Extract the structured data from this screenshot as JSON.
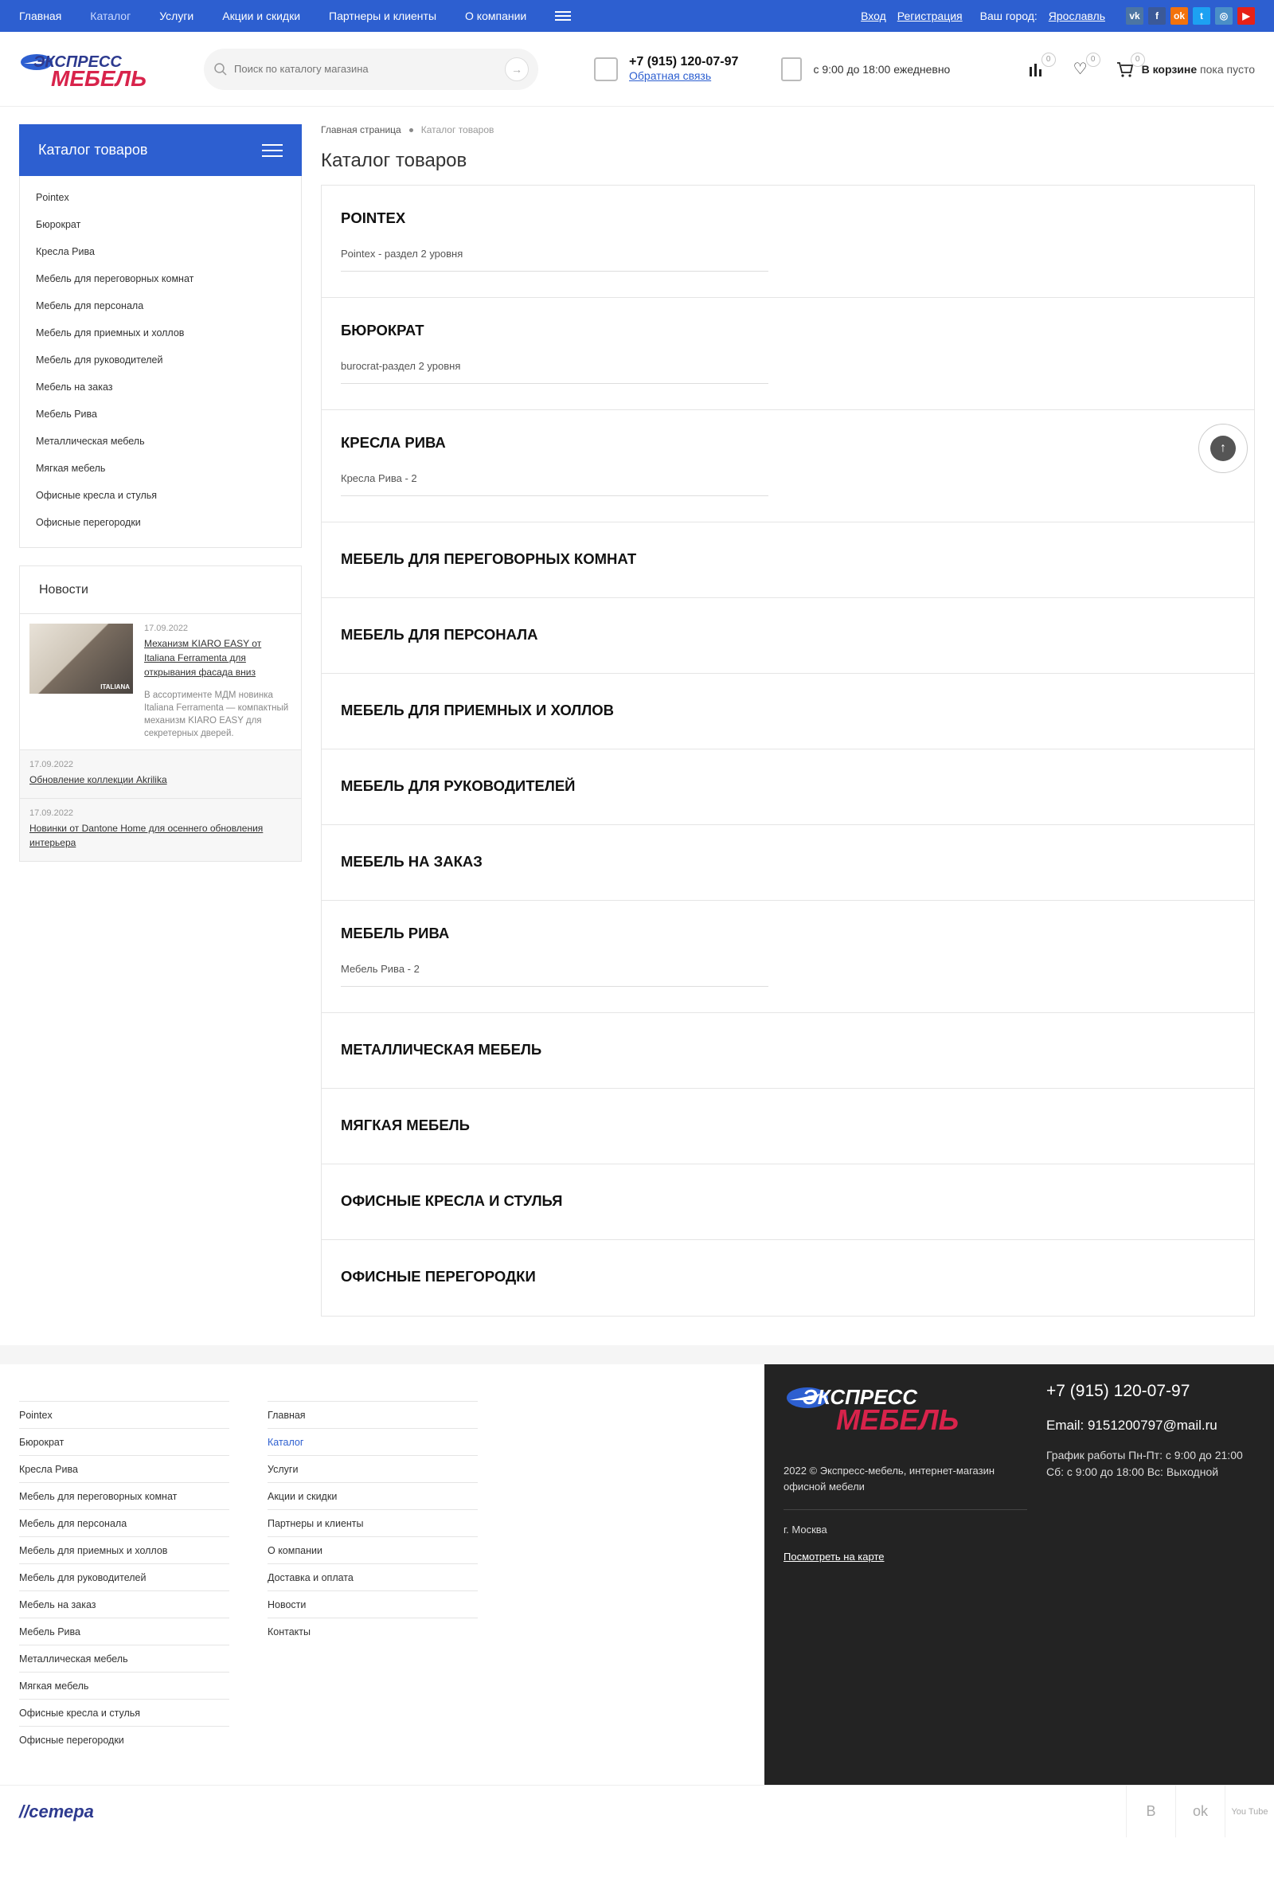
{
  "topbar": {
    "nav": [
      "Главная",
      "Каталог",
      "Услуги",
      "Акции и скидки",
      "Партнеры и клиенты",
      "О компании"
    ],
    "login": "Вход",
    "register": "Регистрация",
    "city_label": "Ваш город:",
    "city": "Ярославль",
    "socials": [
      {
        "icon": "vk-icon",
        "glyph": "vk",
        "color": "#4c75a3"
      },
      {
        "icon": "facebook-icon",
        "glyph": "f",
        "color": "#3b5998"
      },
      {
        "icon": "odnoklassniki-icon",
        "glyph": "ok",
        "color": "#f2720c"
      },
      {
        "icon": "twitter-icon",
        "glyph": "t",
        "color": "#1da1f2"
      },
      {
        "icon": "instagram-icon",
        "glyph": "◎",
        "color": "#4a8fc7"
      },
      {
        "icon": "youtube-icon",
        "glyph": "▶",
        "color": "#e62117"
      }
    ]
  },
  "header": {
    "logo_top": "ЭКСПРЕСС",
    "logo_bottom": "МЕБЕЛЬ",
    "search_placeholder": "Поиск по каталогу магазина",
    "phone": "+7 (915) 120-07-97",
    "callback": "Обратная связь",
    "hours": "с 9:00 до 18:00 ежедневно",
    "compare_count": "0",
    "wish_count": "0",
    "cart_count": "0",
    "cart_label": "В корзине",
    "cart_state": "пока пусто"
  },
  "sidebar": {
    "catalog_title": "Каталог товаров",
    "items": [
      "Pointex",
      "Бюрократ",
      "Кресла Рива",
      "Мебель для переговорных комнат",
      "Мебель для персонала",
      "Мебель для приемных и холлов",
      "Мебель для руководителей",
      "Мебель на заказ",
      "Мебель Рива",
      "Металлическая мебель",
      "Мягкая мебель",
      "Офисные кресла и стулья",
      "Офисные перегородки"
    ],
    "news_title": "Новости",
    "news_first": {
      "date": "17.09.2022",
      "title": "Механизм KIARO EASY от Italiana Ferramenta для открывания фасада вниз",
      "desc": "В ассортименте МДМ новинка Italiana Ferramenta — компактный механизм KIARO EASY для секретерных дверей.",
      "img_label": "ITALIANA"
    },
    "news_items": [
      {
        "date": "17.09.2022",
        "title": "Обновление коллекции Akrilika"
      },
      {
        "date": "17.09.2022",
        "title": "Новинки от Dantone Home для осеннего обновления интерьера"
      }
    ]
  },
  "main": {
    "breadcrumb_home": "Главная страница",
    "breadcrumb_current": "Каталог товаров",
    "title": "Каталог товаров",
    "sections": [
      {
        "title": "Pointex",
        "sub": "Pointex - раздел 2 уровня"
      },
      {
        "title": "Бюрократ",
        "sub": "burocrat-раздел 2 уровня"
      },
      {
        "title": "Кресла Рива",
        "sub": "Кресла Рива - 2"
      },
      {
        "title": "Мебель для переговорных комнат",
        "sub": ""
      },
      {
        "title": "Мебель для персонала",
        "sub": ""
      },
      {
        "title": "Мебель для приемных и холлов",
        "sub": ""
      },
      {
        "title": "Мебель для руководителей",
        "sub": ""
      },
      {
        "title": "Мебель на заказ",
        "sub": ""
      },
      {
        "title": "Мебель Рива",
        "sub": "Мебель Рива - 2"
      },
      {
        "title": "Металлическая мебель",
        "sub": ""
      },
      {
        "title": "Мягкая мебель",
        "sub": ""
      },
      {
        "title": "Офисные кресла и стулья",
        "sub": ""
      },
      {
        "title": "Офисные перегородки",
        "sub": ""
      }
    ]
  },
  "footer": {
    "catalog_links": [
      "Pointex",
      "Бюрократ",
      "Кресла Рива",
      "Мебель для переговорных комнат",
      "Мебель для персонала",
      "Мебель для приемных и холлов",
      "Мебель для руководителей",
      "Мебель на заказ",
      "Мебель Рива",
      "Металлическая мебель",
      "Мягкая мебель",
      "Офисные кресла и стулья",
      "Офисные перегородки"
    ],
    "menu_links": [
      "Главная",
      "Каталог",
      "Услуги",
      "Акции и скидки",
      "Партнеры и клиенты",
      "О компании",
      "Доставка и оплата",
      "Новости",
      "Контакты"
    ],
    "copyright": "2022 © Экспресс-мебель, интернет-магазин офисной мебели",
    "city": "г. Москва",
    "map_link": "Посмотреть на карте",
    "phone": "+7 (915) 120-07-97",
    "email": "Email: 9151200797@mail.ru",
    "schedule1": "График работы Пн-Пт: с 9:00 до 21:00",
    "schedule2": "Сб: с 9:00 до 18:00 Вс: Выходной",
    "developer": "сетера",
    "bottom_icons": [
      "B",
      "ok",
      "You Tube"
    ]
  },
  "colors": {
    "brand_blue": "#2d5fd0",
    "brand_red": "#d8234b",
    "dark": "#232323"
  }
}
